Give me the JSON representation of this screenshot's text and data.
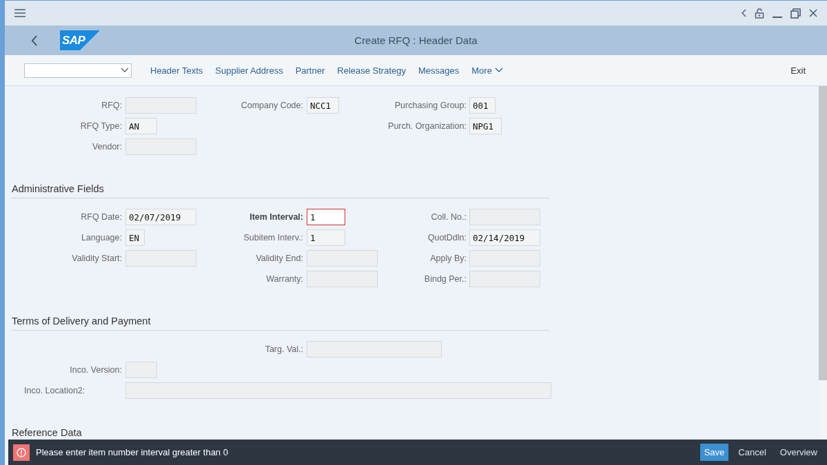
{
  "window": {
    "title": "Create RFQ : Header Data",
    "logo": "SAP"
  },
  "toolbar": {
    "items": [
      {
        "label": "Header Texts",
        "kind": "link"
      },
      {
        "label": "Supplier Address",
        "kind": "link"
      },
      {
        "label": "Partner",
        "kind": "link"
      },
      {
        "label": "Release Strategy",
        "kind": "link"
      },
      {
        "label": "Messages",
        "kind": "link"
      },
      {
        "label": "More",
        "kind": "menu"
      }
    ],
    "exit": "Exit"
  },
  "sections": [
    {
      "rows": [
        [
          {
            "label": "RFQ:"
          },
          {
            "label": "Company Code:",
            "value": "NCC1"
          },
          {
            "label": "Purchasing Group:",
            "value": "001"
          }
        ],
        [
          {
            "label": "RFQ Type:",
            "value": "AN"
          },
          null,
          {
            "label": "Purch. Organization:",
            "value": "NPG1"
          }
        ],
        [
          {
            "label": "Vendor:"
          },
          null,
          null
        ]
      ]
    },
    {
      "title": "Administrative Fields",
      "rows": [
        [
          {
            "label": "RFQ Date:",
            "value": "02/07/2019"
          },
          {
            "label": "Item Interval:",
            "value": "1",
            "error": true
          },
          {
            "label": "Coll. No.:"
          }
        ],
        [
          {
            "label": "Language:",
            "value": "EN"
          },
          {
            "label": "Subitem Interv.:",
            "value": "1"
          },
          {
            "label": "QuotDdln:",
            "value": "02/14/2019"
          }
        ],
        [
          {
            "label": "Validity Start:"
          },
          {
            "label": "Validity End:"
          },
          {
            "label": "Apply By:"
          }
        ],
        [
          null,
          {
            "label": "Warranty:"
          },
          {
            "label": "Bindg Per.:"
          }
        ]
      ]
    },
    {
      "title": "Terms of Delivery and Payment",
      "rows": [
        [
          null,
          {
            "label": "Targ. Val.:"
          },
          null
        ],
        [
          {
            "label": "Inco. Version:"
          },
          null,
          null
        ],
        [
          {
            "label": "Inco. Location2:"
          },
          null,
          null
        ]
      ]
    },
    {
      "title": "Reference Data"
    }
  ],
  "message": {
    "text": "Please enter item number interval greater than 0"
  },
  "footer_buttons": [
    {
      "label": "Save",
      "primary": true
    },
    {
      "label": "Cancel",
      "primary": false
    },
    {
      "label": "Overview",
      "primary": false
    }
  ]
}
